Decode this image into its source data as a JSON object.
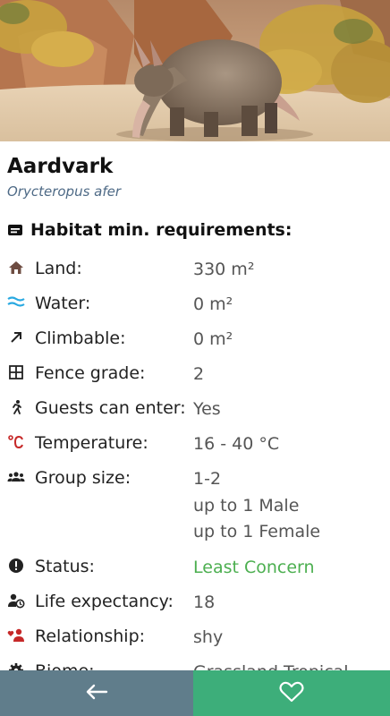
{
  "animal": {
    "name": "Aardvark",
    "scientific_name": "Orycteropus afer"
  },
  "habitat": {
    "heading": "Habitat min. requirements:",
    "rows": [
      {
        "icon": "house-icon",
        "label": "Land:",
        "value": "330 m²"
      },
      {
        "icon": "water-icon",
        "label": "Water:",
        "value": "0 m²"
      },
      {
        "icon": "arrow-up-right-icon",
        "label": "Climbable:",
        "value": "0 m²"
      },
      {
        "icon": "grid-icon",
        "label": "Fence grade:",
        "value": "2"
      },
      {
        "icon": "walking-person-icon",
        "label": "Guests can enter:",
        "value": "Yes"
      },
      {
        "icon": "celsius-icon",
        "label": "Temperature:",
        "value": "16 - 40 °C"
      },
      {
        "icon": "group-icon",
        "label": "Group size:",
        "value": "1-2",
        "value2": "up to 1 Male",
        "value3": "up to 1 Female"
      },
      {
        "icon": "alert-icon",
        "label": "Status:",
        "value": "Least Concern"
      },
      {
        "icon": "life-expectancy-icon",
        "label": "Life expectancy:",
        "value": "18"
      },
      {
        "icon": "relationship-icon",
        "label": "Relationship:",
        "value": "shy"
      },
      {
        "icon": "gear-icon",
        "label": "Biome:",
        "value": "Grassland Tropical"
      }
    ]
  },
  "colors": {
    "status_green": "#4caf50",
    "back_bar": "#607d8b",
    "fav_bar": "#3dae7a",
    "subtitle": "#4e6a86",
    "water_icon": "#29a9e1",
    "temp_icon": "#c62828",
    "relationship_icon": "#c62828"
  }
}
